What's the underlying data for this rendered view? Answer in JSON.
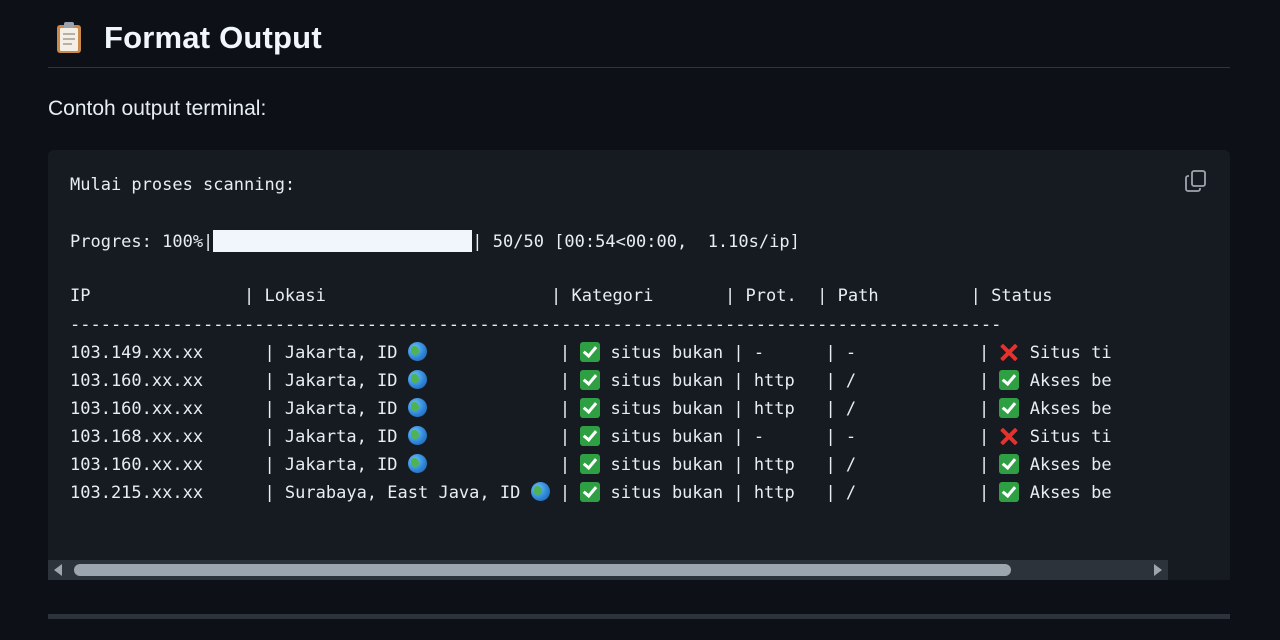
{
  "section": {
    "heading": "Format Output",
    "heading_icon": "clipboard-icon",
    "intro": "Contoh output terminal:"
  },
  "code": {
    "line_scan": "Mulai proses scanning:",
    "progress": {
      "prefix": "Progres: 100%|",
      "fraction": 1.0,
      "suffix": "| 50/50 [00:54<00:00,  1.10s/ip]"
    },
    "header": "IP               | Lokasi                      | Kategori       | Prot.  | Path         | Status",
    "divider": "-------------------------------------------------------------------------------------------",
    "rows": [
      {
        "ip_loc": "103.149.xx.xx      | Jakarta, ID ",
        "gap": "             | ",
        "kategori": " situs bukan | -      | -            | ",
        "status_icon": "cross",
        "status": " Situs ti"
      },
      {
        "ip_loc": "103.160.xx.xx      | Jakarta, ID ",
        "gap": "             | ",
        "kategori": " situs bukan | http   | /            | ",
        "status_icon": "check",
        "status": " Akses be"
      },
      {
        "ip_loc": "103.160.xx.xx      | Jakarta, ID ",
        "gap": "             | ",
        "kategori": " situs bukan | http   | /            | ",
        "status_icon": "check",
        "status": " Akses be"
      },
      {
        "ip_loc": "103.168.xx.xx      | Jakarta, ID ",
        "gap": "             | ",
        "kategori": " situs bukan | -      | -            | ",
        "status_icon": "cross",
        "status": " Situs ti"
      },
      {
        "ip_loc": "103.160.xx.xx      | Jakarta, ID ",
        "gap": "             | ",
        "kategori": " situs bukan | http   | /            | ",
        "status_icon": "check",
        "status": " Akses be"
      },
      {
        "ip_loc": "103.215.xx.xx      | Surabaya, East Java, ID ",
        "gap": " | ",
        "kategori": " situs bukan | http   | /            | ",
        "status_icon": "check",
        "status": " Akses be"
      }
    ],
    "scrollbar": {
      "position": 0.0
    }
  },
  "colors": {
    "page_bg": "#0d1117",
    "code_bg": "#161b22",
    "check": "#2ea043",
    "cross": "#e5322d"
  }
}
